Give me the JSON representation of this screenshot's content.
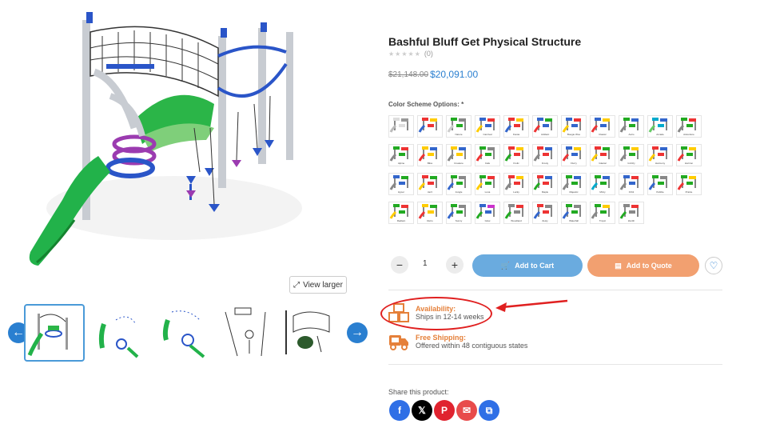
{
  "product": {
    "title": "Bashful Bluff Get Physical Structure",
    "stars": "★★★★★",
    "review_count": "(0)",
    "old_price": "$21,148.00",
    "new_price": "$20,091.00",
    "color_label": "Color Scheme Options: *"
  },
  "gallery": {
    "view_larger": "View larger"
  },
  "swatches": [
    {
      "label": "",
      "tones": [
        "#ddd",
        "#999",
        "#bbb"
      ]
    },
    {
      "label": "",
      "tones": [
        "#e33",
        "#fc0",
        "#36c"
      ]
    },
    {
      "label": "Nature",
      "tones": [
        "#2a2",
        "#888",
        "#ccc"
      ]
    },
    {
      "label": "Carnival",
      "tones": [
        "#36c",
        "#e33",
        "#fc0"
      ]
    },
    {
      "label": "Fiesta",
      "tones": [
        "#e33",
        "#fc0",
        "#36c"
      ]
    },
    {
      "label": "Jubilant",
      "tones": [
        "#36c",
        "#2a2",
        "#e33"
      ]
    },
    {
      "label": "Boogie Woo",
      "tones": [
        "#36c",
        "#e33",
        "#fc0"
      ]
    },
    {
      "label": "Classic",
      "tones": [
        "#36c",
        "#fc0",
        "#e33"
      ]
    },
    {
      "label": "Astro",
      "tones": [
        "#2a2",
        "#36c",
        "#888"
      ]
    },
    {
      "label": "Arcade",
      "tones": [
        "#0ac",
        "#36c",
        "#6c6"
      ]
    },
    {
      "label": "Adventure",
      "tones": [
        "#2a2",
        "#e33",
        "#888"
      ]
    },
    {
      "label": "Alpine",
      "tones": [
        "#2a2",
        "#e33",
        "#888"
      ]
    },
    {
      "label": "Bliss",
      "tones": [
        "#fc0",
        "#36c",
        "#e33"
      ]
    },
    {
      "label": "Creature",
      "tones": [
        "#fc0",
        "#36c",
        "#888"
      ]
    },
    {
      "label": "Cafe",
      "tones": [
        "#2a2",
        "#888",
        "#e33"
      ]
    },
    {
      "label": "Frolic",
      "tones": [
        "#e33",
        "#fc0",
        "#2a2"
      ]
    },
    {
      "label": "Frosty",
      "tones": [
        "#e33",
        "#36c",
        "#888"
      ]
    },
    {
      "label": "Flurry",
      "tones": [
        "#36c",
        "#fc0",
        "#e33"
      ]
    },
    {
      "label": "Glacial",
      "tones": [
        "#e33",
        "#2a2",
        "#fc0"
      ]
    },
    {
      "label": "Grizzly",
      "tones": [
        "#2a2",
        "#fc0",
        "#888"
      ]
    },
    {
      "label": "Harmony",
      "tones": [
        "#e33",
        "#36c",
        "#fc0"
      ]
    },
    {
      "label": "Horizon",
      "tones": [
        "#2a2",
        "#fc0",
        "#e33"
      ]
    },
    {
      "label": "Hyper",
      "tones": [
        "#36c",
        "#2a2",
        "#888"
      ]
    },
    {
      "label": "Jazz",
      "tones": [
        "#e33",
        "#2a2",
        "#fc0"
      ]
    },
    {
      "label": "Jungle",
      "tones": [
        "#2a2",
        "#888",
        "#36c"
      ]
    },
    {
      "label": "Luna",
      "tones": [
        "#2a2",
        "#e33",
        "#fc0"
      ]
    },
    {
      "label": "Lucky",
      "tones": [
        "#e33",
        "#fc0",
        "#888"
      ]
    },
    {
      "label": "Maple",
      "tones": [
        "#e33",
        "#36c",
        "#2a2"
      ]
    },
    {
      "label": "Majestic",
      "tones": [
        "#2a2",
        "#36c",
        "#888"
      ]
    },
    {
      "label": "Minty",
      "tones": [
        "#2a2",
        "#36c",
        "#0ac"
      ]
    },
    {
      "label": "Orbit",
      "tones": [
        "#36c",
        "#e33",
        "#888"
      ]
    },
    {
      "label": "Pebble",
      "tones": [
        "#2a2",
        "#888",
        "#36c"
      ]
    },
    {
      "label": "Prairie",
      "tones": [
        "#2a2",
        "#fc0",
        "#e33"
      ]
    },
    {
      "label": "Radiant",
      "tones": [
        "#2a2",
        "#e33",
        "#fc0"
      ]
    },
    {
      "label": "Retro",
      "tones": [
        "#fc0",
        "#2a2",
        "#e33"
      ]
    },
    {
      "label": "Sunny",
      "tones": [
        "#2a2",
        "#888",
        "#36c"
      ]
    },
    {
      "label": "Glow",
      "tones": [
        "#36c",
        "#c3c",
        "#2a2"
      ]
    },
    {
      "label": "Woodland",
      "tones": [
        "#888",
        "#e33",
        "#2a2"
      ]
    },
    {
      "label": "Zesty",
      "tones": [
        "#e33",
        "#888",
        "#36c"
      ]
    },
    {
      "label": "Waterfall",
      "tones": [
        "#2a2",
        "#888",
        "#36c"
      ]
    },
    {
      "label": "Tropic",
      "tones": [
        "#2a2",
        "#fc0",
        "#888"
      ]
    },
    {
      "label": "Zenith",
      "tones": [
        "#888",
        "#e33",
        "#2a2"
      ]
    }
  ],
  "cart": {
    "minus": "−",
    "qty": "1",
    "plus": "+",
    "add_to_cart": "Add to Cart",
    "add_to_quote": "Add to Quote"
  },
  "availability": {
    "title": "Availability:",
    "text": "Ships in 12-14 weeks"
  },
  "shipping": {
    "title": "Free Shipping:",
    "text": "Offered within 48 contiguous states"
  },
  "share": {
    "label": "Share this product:",
    "networks": [
      {
        "name": "facebook",
        "glyph": "f",
        "color": "#2f6fe6"
      },
      {
        "name": "x",
        "glyph": "𝕏",
        "color": "#000000"
      },
      {
        "name": "pinterest",
        "glyph": "P",
        "color": "#e0232f"
      },
      {
        "name": "email",
        "glyph": "✉",
        "color": "#e84b4b"
      },
      {
        "name": "copy",
        "glyph": "⧉",
        "color": "#2f6fe6"
      }
    ]
  },
  "colors": {
    "accent_blue": "#2a7fd0",
    "cart_button": "#6aabdf",
    "quote_button": "#f2a070",
    "info_orange": "#e5803a",
    "annotation_red": "#e02020"
  }
}
